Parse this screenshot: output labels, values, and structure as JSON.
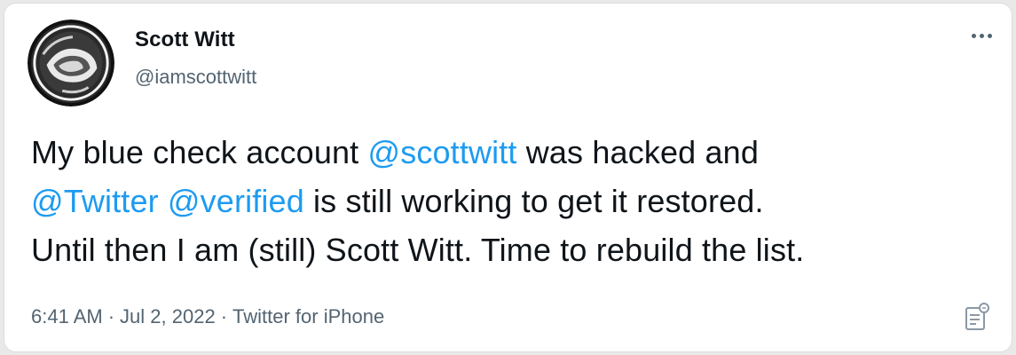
{
  "author": {
    "name": "Scott Witt",
    "handle": "@iamscottwitt",
    "avatar": "avatar-icon"
  },
  "tweet": {
    "line1": {
      "pre": "My blue check account ",
      "mention": "@scottwitt",
      "post": " was hacked and"
    },
    "line2": {
      "mention1": "@Twitter",
      "space": " ",
      "mention2": "@verified",
      "post": " is still working to get it restored."
    },
    "line3": "Until then I am (still) Scott Witt. Time to rebuild the list."
  },
  "meta": {
    "time": "6:41 AM",
    "separator": "·",
    "date": "Jul 2, 2022",
    "source": "Twitter for iPhone"
  },
  "colors": {
    "mention": "#1d9bf0",
    "secondary_text": "#536471",
    "primary_text": "#0f1419"
  },
  "icons": {
    "more": "more-horizontal-icon",
    "analytics": "tweet-analytics-icon"
  }
}
